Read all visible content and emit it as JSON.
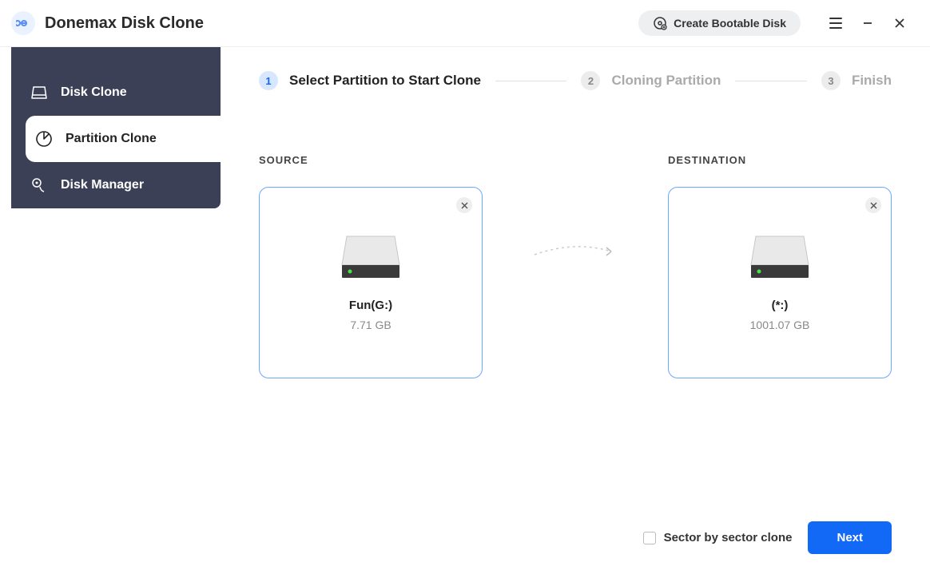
{
  "app": {
    "title": "Donemax Disk Clone"
  },
  "titlebar": {
    "bootable": "Create Bootable Disk"
  },
  "sidebar": {
    "items": [
      {
        "label": "Disk Clone"
      },
      {
        "label": "Partition Clone"
      },
      {
        "label": "Disk Manager"
      }
    ]
  },
  "steps": {
    "s1": {
      "num": "1",
      "label": "Select Partition to Start Clone"
    },
    "s2": {
      "num": "2",
      "label": "Cloning Partition"
    },
    "s3": {
      "num": "3",
      "label": "Finish"
    }
  },
  "panels": {
    "source": {
      "header": "SOURCE",
      "name": "Fun(G:)",
      "size": "7.71 GB"
    },
    "destination": {
      "header": "DESTINATION",
      "name": "(*:)",
      "size": "1001.07 GB"
    }
  },
  "footer": {
    "checkbox": "Sector by sector clone",
    "next": "Next"
  }
}
